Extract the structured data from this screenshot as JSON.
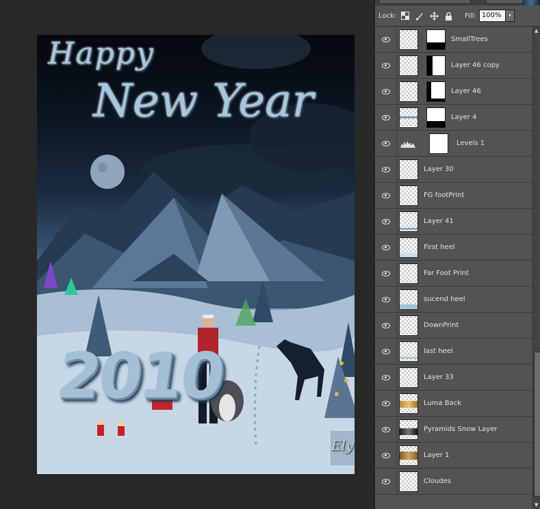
{
  "canvas": {
    "title_line1": "Happy",
    "title_line2": "New Year",
    "year_text": "2010",
    "signature_text": "Ely"
  },
  "layers_panel": {
    "lock_label": "Lock:",
    "lock_icons": [
      "lock-transparent-pixels-icon",
      "lock-image-pixels-icon",
      "lock-position-icon",
      "lock-all-icon"
    ],
    "fill_label": "Fill:",
    "fill_value": "100%",
    "layers": [
      {
        "name": "SmallTrees",
        "thumb": "pixel",
        "mask": true
      },
      {
        "name": "Layer 46 copy",
        "thumb": "pixel",
        "mask": true
      },
      {
        "name": "Layer 46",
        "thumb": "pixel",
        "mask": true
      },
      {
        "name": "Layer 4",
        "thumb": "pixel",
        "mask": true
      },
      {
        "name": "Levels 1",
        "thumb": "adjustment",
        "mask": true
      },
      {
        "name": "Layer 30",
        "thumb": "pixel",
        "mask": false
      },
      {
        "name": "FG footPrint",
        "thumb": "pixel",
        "mask": false
      },
      {
        "name": "Layer 41",
        "thumb": "pixel",
        "mask": false
      },
      {
        "name": "First heel",
        "thumb": "pixel",
        "mask": false
      },
      {
        "name": "Far Foot Print",
        "thumb": "pixel",
        "mask": false
      },
      {
        "name": "sucend heel",
        "thumb": "pixel",
        "mask": false
      },
      {
        "name": "DownPrint",
        "thumb": "pixel",
        "mask": false
      },
      {
        "name": "last heel",
        "thumb": "pixel",
        "mask": false
      },
      {
        "name": "Layer 33",
        "thumb": "pixel",
        "mask": false
      },
      {
        "name": "Luma Back",
        "thumb": "pixel",
        "mask": false
      },
      {
        "name": "Pyramids Snow Layer",
        "thumb": "pixel",
        "mask": false
      },
      {
        "name": "Layer 1",
        "thumb": "pixel",
        "mask": false
      },
      {
        "name": "Cloudes",
        "thumb": "pixel",
        "mask": false
      }
    ]
  },
  "colors": {
    "panel_bg": "#535353",
    "workspace_bg": "#282828",
    "title_ice": "#a9c7dc"
  }
}
